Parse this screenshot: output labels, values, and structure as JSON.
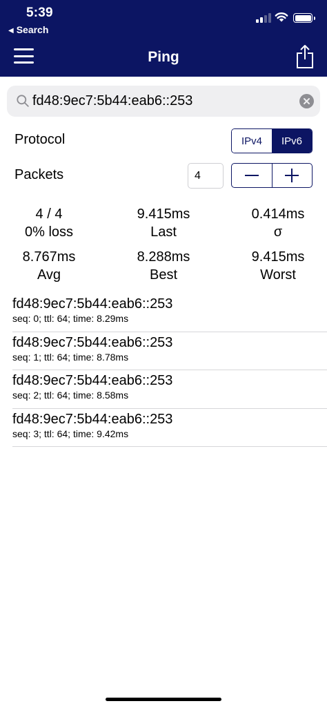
{
  "status_bar": {
    "time": "5:39",
    "back_label": "Search",
    "back_icon": "back-triangle-icon"
  },
  "nav": {
    "title": "Ping",
    "menu_icon": "hamburger-menu-icon",
    "share_icon": "share-icon"
  },
  "search": {
    "value": "fd48:9ec7:5b44:eab6::253",
    "placeholder": ""
  },
  "protocol": {
    "label": "Protocol",
    "options": [
      "IPv4",
      "IPv6"
    ],
    "selected": "IPv6"
  },
  "packets": {
    "label": "Packets",
    "value": "4",
    "minus_symbol": "−",
    "plus_symbol": "+"
  },
  "stats": [
    {
      "value": "4 / 4",
      "label": "0% loss"
    },
    {
      "value": "9.415ms",
      "label": "Last"
    },
    {
      "value": "0.414ms",
      "label": "σ"
    },
    {
      "value": "8.767ms",
      "label": "Avg"
    },
    {
      "value": "8.288ms",
      "label": "Best"
    },
    {
      "value": "9.415ms",
      "label": "Worst"
    }
  ],
  "results": [
    {
      "host": "fd48:9ec7:5b44:eab6::253",
      "detail": "seq: 0; ttl: 64; time: 8.29ms"
    },
    {
      "host": "fd48:9ec7:5b44:eab6::253",
      "detail": "seq: 1; ttl: 64; time: 8.78ms"
    },
    {
      "host": "fd48:9ec7:5b44:eab6::253",
      "detail": "seq: 2; ttl: 64; time: 8.58ms"
    },
    {
      "host": "fd48:9ec7:5b44:eab6::253",
      "detail": "seq: 3; ttl: 64; time: 9.42ms"
    }
  ],
  "colors": {
    "header_bg": "#0c1563",
    "accent": "#0c1563",
    "search_bg": "#efeff1",
    "divider": "#d6d6d9"
  }
}
